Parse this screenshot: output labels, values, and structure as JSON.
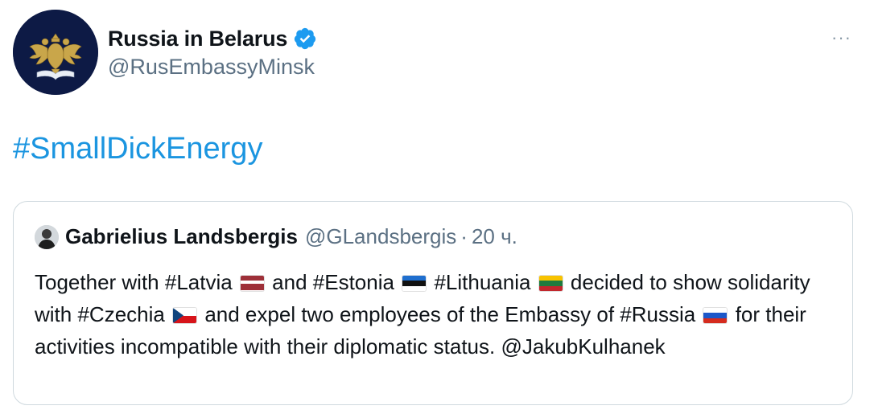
{
  "author": {
    "display_name": "Russia in Belarus",
    "handle": "@RusEmbassyMinsk",
    "verified_icon": "verified-badge-icon",
    "avatar_icon": "double-headed-eagle-emblem-icon"
  },
  "tweet": {
    "text": "#SmallDickEnergy"
  },
  "menu": {
    "more_label": "···"
  },
  "quoted": {
    "display_name": "Gabrielius Landsbergis",
    "handle": "@GLandsbergis",
    "separator": "·",
    "time": "20 ч.",
    "segments": {
      "s1": "Together with ",
      "latvia": "#Latvia",
      "s2": " and ",
      "estonia": "#Estonia",
      "s3": " ",
      "lithuania": "#Lithuania",
      "s4": " decided to show solidarity with ",
      "czechia": "#Czechia",
      "s5": " and expel two employees of the Embassy of ",
      "russia": "#Russia",
      "s6": " for their activities incompatible with their diplomatic status. ",
      "mention": "@JakubKulhanek"
    },
    "flags": [
      "flag-latvia",
      "flag-estonia",
      "flag-lithuania",
      "flag-czechia",
      "flag-russia"
    ]
  },
  "colors": {
    "link": "#1b95e0",
    "secondary_text": "#5b7083",
    "border": "#cfd9de",
    "avatar_bg": "#0d1a45"
  }
}
